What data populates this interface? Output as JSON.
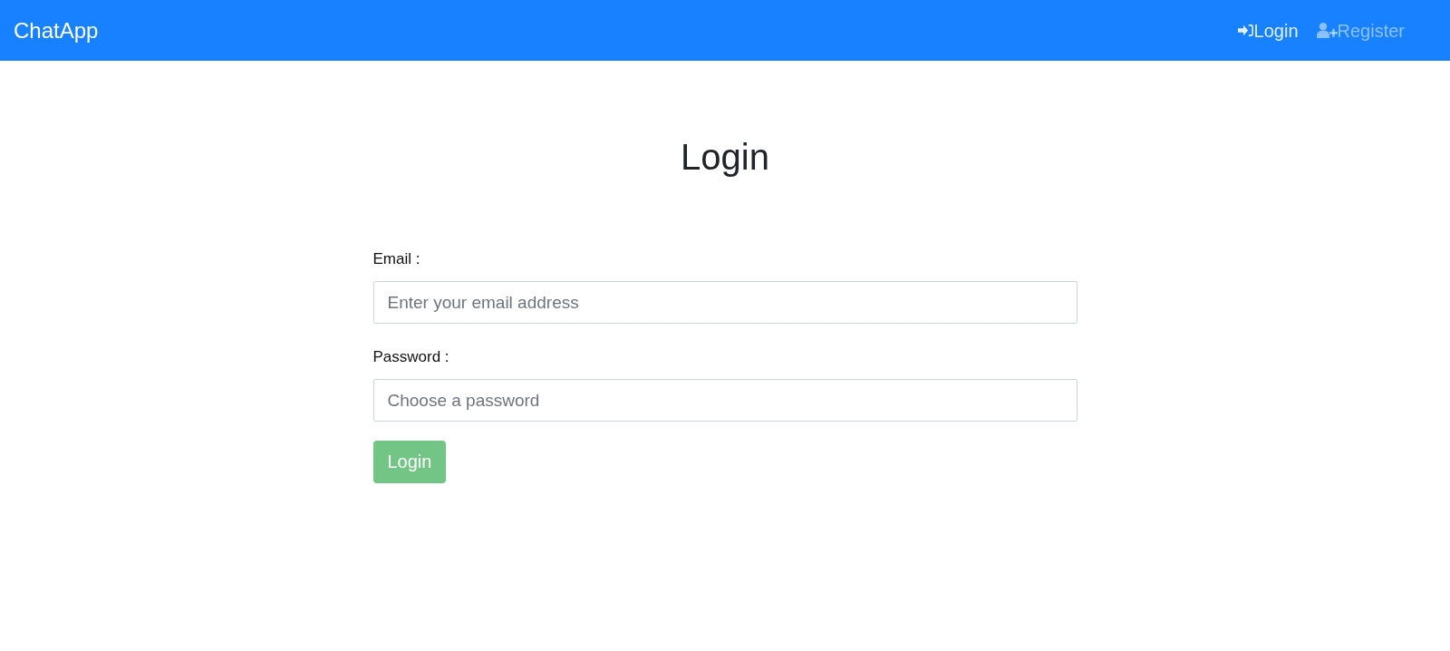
{
  "navbar": {
    "brand": "ChatApp",
    "links": [
      {
        "label": "Login",
        "selected": true
      },
      {
        "label": "Register",
        "selected": false
      }
    ]
  },
  "heading": "Login",
  "form": {
    "fields": [
      {
        "label": "Email :",
        "placeholder": "Enter your email address"
      },
      {
        "label": "Password :",
        "placeholder": "Choose a password"
      }
    ],
    "submit": {
      "label": "Login",
      "disabled": true
    }
  }
}
